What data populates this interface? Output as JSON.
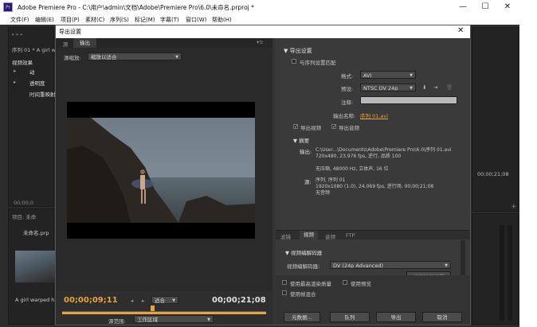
{
  "app": {
    "icon_text": "Pr",
    "title": "Adobe Premiere Pro - C:\\用户\\admin\\文档\\Adobe\\Premiere Pro\\6.0\\未命名.prproj *",
    "minimize": "—",
    "maximize": "☐",
    "close": "✕"
  },
  "menu": [
    "文件(F)",
    "编辑(E)",
    "项目(P)",
    "素材(C)",
    "序列(S)",
    "标记(M)",
    "字幕(T)",
    "窗口(W)",
    "帮助(H)"
  ],
  "bg": {
    "effects_title": "视频效果",
    "seq_tab": "序列 01 * A girl w",
    "effects_items": [
      "运动",
      "透明度",
      "时间重映射"
    ],
    "time_small": "00;00;0",
    "project_tab": "项目: 未命",
    "project_name": "未命名.prp",
    "clip_caption": "A girl warped h",
    "right_time": "00;00;21;08",
    "motion_label": "动"
  },
  "dialog": {
    "title": "导出设置",
    "close": "✕",
    "left_tabs": [
      "源",
      "输出"
    ],
    "scale_label": "源缩放:",
    "scale_value": "缩放以适合",
    "timecode_current": "00;00;09;11",
    "fit_value": "适合",
    "timecode_end": "00;00;21;08",
    "source_range_label": "源范围:",
    "source_range_value": "工作区域",
    "export_settings_title": "导出设置",
    "match_sequence": "与序列设置匹配",
    "format_label": "格式:",
    "format_value": "AVI",
    "preset_label": "预设:",
    "preset_value": "NTSC DV 24p",
    "comment_label": "注释:",
    "output_name_label": "输出名称:",
    "output_name_value": "序列 01.avi",
    "export_video": "导出视频",
    "export_audio": "导出音频",
    "summary_title": "摘要",
    "summary_output_label": "输出:",
    "summary_output_lines": [
      "C:\\User...\\Documents\\Adobe\\Premiere Pro\\6.0\\序列 01.avi",
      "720x480, 23.976 fps, 逆行, 品质 100",
      "",
      "无压缩, 48000 Hz, 立体声, 16 位"
    ],
    "summary_source_label": "源:",
    "summary_source_lines": [
      "序列, 序列 01",
      "1920x1080 (1.0), 24.069 fps, 逆行场, 00;00;21;08",
      "无音频"
    ],
    "right_tabs": [
      "滤镜",
      "视频",
      "音频",
      "FTP"
    ],
    "codec_section": "视频编解码器",
    "codec_label": "视频编解码器:",
    "codec_value": "DV (24p Advanced)",
    "codec_settings_btn": "编解码器设置",
    "max_render_quality": "使用最高渲染质量",
    "use_preview": "使用预览",
    "use_frame_blending": "使用帧混合",
    "btn_metadata": "元数据...",
    "btn_queue": "队列",
    "btn_export": "导出",
    "btn_cancel": "取消"
  },
  "colors": {
    "accent_orange": "#e8a33b",
    "panel_bg": "#2a2a2a",
    "dialog_bg": "#3a3a3a"
  },
  "playhead_fraction": 0.44
}
